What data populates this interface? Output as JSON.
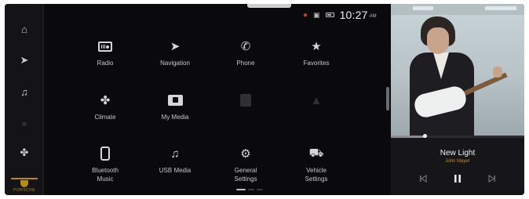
{
  "status_bar": {
    "time": "10:27",
    "ampm": "AM",
    "icons": [
      "mic-off-icon",
      "cast-icon",
      "battery-icon"
    ],
    "mic_color": "#c23b3b"
  },
  "rail": {
    "items": [
      {
        "name": "home",
        "icon": "home-icon",
        "glyph": "⌂"
      },
      {
        "name": "navigation",
        "icon": "navigation-arrow-icon",
        "glyph": "➤"
      },
      {
        "name": "music",
        "icon": "music-note-icon",
        "glyph": "♫"
      },
      {
        "name": "empty",
        "icon": "blank-icon",
        "glyph": "●"
      },
      {
        "name": "climate",
        "icon": "fan-icon",
        "glyph": "✤"
      }
    ],
    "logo_text": "PORSCHE"
  },
  "apps": [
    {
      "label": "Radio",
      "icon": "radio-icon",
      "glyph": ""
    },
    {
      "label": "Navigation",
      "icon": "navigation-arrow-icon",
      "glyph": "➤"
    },
    {
      "label": "Phone",
      "icon": "phone-icon",
      "glyph": "✆"
    },
    {
      "label": "Favorites",
      "icon": "star-icon",
      "glyph": "★"
    },
    {
      "label": "Climate",
      "icon": "fan-icon",
      "glyph": "✤"
    },
    {
      "label": "My Media",
      "icon": "folder-icon",
      "glyph": ""
    },
    {
      "label": "",
      "icon": "disabled-app-icon",
      "glyph": ""
    },
    {
      "label": "",
      "icon": "disabled-app-icon",
      "glyph": "▲"
    },
    {
      "label": "Bluetooth\nMusic",
      "icon": "bluetooth-phone-icon",
      "glyph": ""
    },
    {
      "label": "USB Media",
      "icon": "music-note-icon",
      "glyph": "♫"
    },
    {
      "label": "General\nSettings",
      "icon": "gear-icon",
      "glyph": "⚙"
    },
    {
      "label": "Vehicle\nSettings",
      "icon": "car-settings-icon",
      "glyph": "⛟"
    }
  ],
  "media": {
    "track": "New Light",
    "artist": "John Mayer",
    "progress": 0.25
  },
  "accent_color": "#d08a20"
}
